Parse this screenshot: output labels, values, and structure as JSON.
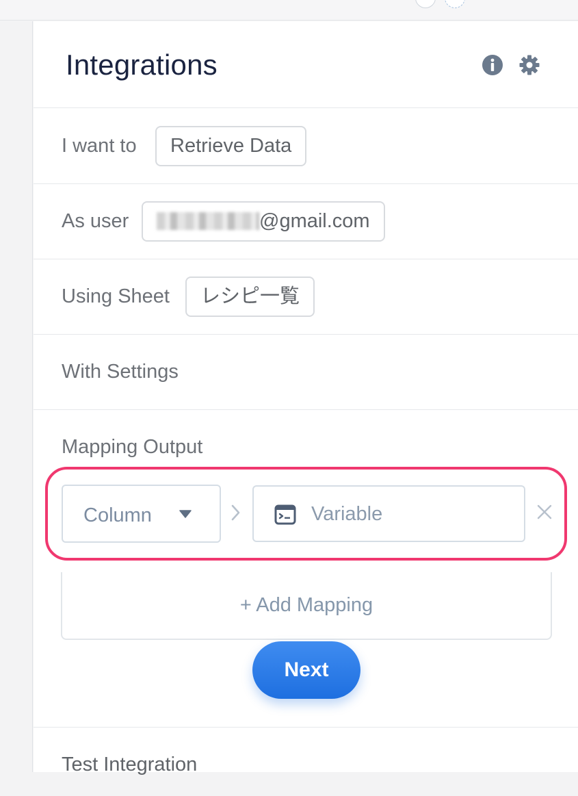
{
  "header": {
    "title": "Integrations",
    "info_icon": "info-icon",
    "settings_icon": "gear-icon"
  },
  "rows": [
    {
      "label": "I want to",
      "value": "Retrieve Data"
    },
    {
      "label": "As user",
      "value": "@gmail.com",
      "value_redacted": true
    },
    {
      "label": "Using Sheet",
      "value": "レシピ一覧"
    },
    {
      "label": "With Settings"
    }
  ],
  "mapping": {
    "label": "Mapping Output",
    "column_select": "Column",
    "variable_placeholder": "Variable",
    "add_label": "+ Add Mapping",
    "highlight_color": "#f0386f"
  },
  "next_button": "Next",
  "test_label": "Test Integration",
  "colors": {
    "primary": "#1e6fe0",
    "title": "#1a2340",
    "muted": "#7c8ca1"
  }
}
